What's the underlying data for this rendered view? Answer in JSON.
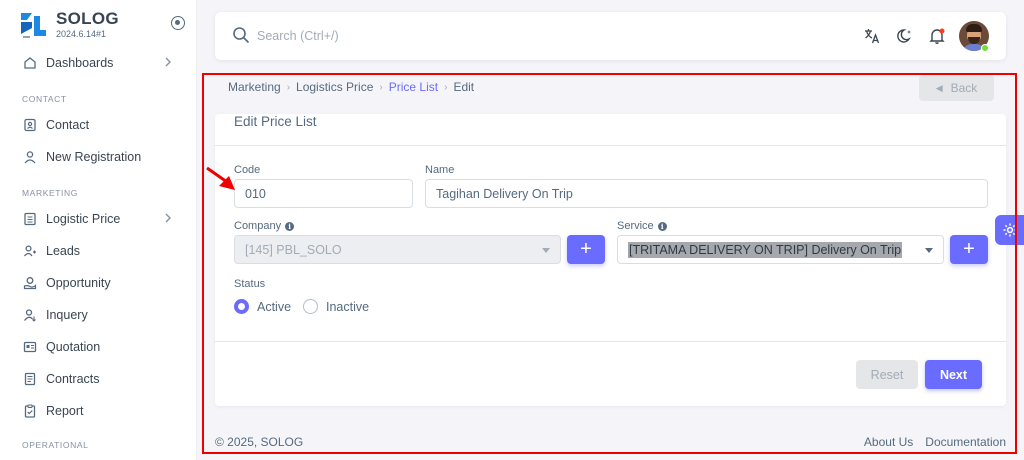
{
  "brand": {
    "name": "SOLOG",
    "version": "2024.6.14#1",
    "logo_color": "#1e88e5"
  },
  "sidebar": {
    "dashboards": "Dashboards",
    "section_contact": "CONTACT",
    "contact": "Contact",
    "new_registration": "New Registration",
    "section_marketing": "MARKETING",
    "logistic_price": "Logistic Price",
    "leads": "Leads",
    "opportunity": "Opportunity",
    "inquery": "Inquery",
    "quotation": "Quotation",
    "contracts": "Contracts",
    "report": "Report",
    "section_operational": "OPERATIONAL"
  },
  "search": {
    "placeholder": "Search (Ctrl+/)"
  },
  "breadcrumb": {
    "item1": "Marketing",
    "item2": "Logistics Price",
    "item3": "Price List",
    "item4": "Edit"
  },
  "back_label": "Back",
  "form": {
    "title": "Edit Price List",
    "code_label": "Code",
    "code_value": "010",
    "name_label": "Name",
    "name_value": "Tagihan Delivery On Trip",
    "company_label": "Company",
    "company_value": "[145] PBL_SOLO",
    "service_label": "Service",
    "service_value": "[TRITAMA DELIVERY ON TRIP] Delivery On Trip",
    "plus_label": "+",
    "status_label": "Status",
    "status_options": [
      "Active",
      "Inactive"
    ],
    "status_selected": "Active",
    "reset_label": "Reset",
    "next_label": "Next"
  },
  "footer": {
    "copyright": "© 2025, SOLOG",
    "about": "About Us",
    "docs": "Documentation"
  },
  "colors": {
    "primary": "#696cff",
    "annotation": "#ee0000"
  }
}
